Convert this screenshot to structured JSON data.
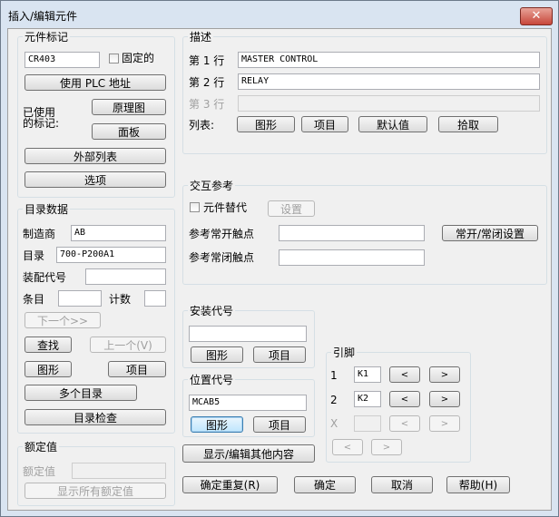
{
  "window": {
    "title": "插入/编辑元件",
    "close_glyph": "✕"
  },
  "component_tag": {
    "group_label": "元件标记",
    "tag_value": "CR403",
    "fixed_label": "固定的",
    "use_plc_label": "使用 PLC 地址",
    "used_tags_label_line1": "已使用",
    "used_tags_label_line2": "的标记:",
    "schematic_label": "原理图",
    "panel_label": "面板",
    "external_list_label": "外部列表",
    "options_label": "选项"
  },
  "catalog": {
    "group_label": "目录数据",
    "manufacturer_label": "制造商",
    "manufacturer_value": "AB",
    "catalog_label": "目录",
    "catalog_value": "700-P200A1",
    "assembly_label": "装配代号",
    "assembly_value": "",
    "item_label": "条目",
    "item_value": "",
    "count_label": "计数",
    "count_value": "",
    "next_label": "下一个>>",
    "lookup_label": "查找",
    "previous_label": "上一个(V)",
    "drawing_label": "图形",
    "project_label": "项目",
    "multiple_label": "多个目录",
    "check_label": "目录检查"
  },
  "ratings": {
    "group_label": "额定值",
    "rating_label": "额定值",
    "rating_value": "",
    "show_all_label": "显示所有额定值"
  },
  "description": {
    "group_label": "描述",
    "line1_label": "第 1 行",
    "line1_value": "MASTER CONTROL",
    "line2_label": "第 2 行",
    "line2_value": "RELAY",
    "line3_label": "第 3 行",
    "line3_value": "",
    "list_label": "列表:",
    "drawing_label": "图形",
    "project_label": "项目",
    "defaults_label": "默认值",
    "pick_label": "拾取"
  },
  "cross_ref": {
    "group_label": "交互参考",
    "override_label": "元件替代",
    "setup_label": "设置",
    "no_contacts_label": "参考常开触点",
    "no_contacts_value": "",
    "nc_contacts_label": "参考常闭触点",
    "nc_contacts_value": "",
    "no_nc_setup_label": "常开/常闭设置"
  },
  "installation": {
    "group_label": "安装代号",
    "value": "",
    "drawing_label": "图形",
    "project_label": "项目"
  },
  "location": {
    "group_label": "位置代号",
    "value": "MCAB5",
    "drawing_label": "图形",
    "project_label": "项目"
  },
  "pins": {
    "group_label": "引脚",
    "row1_label": "1",
    "row1_value": "K1",
    "row2_label": "2",
    "row2_value": "K2",
    "rowx_label": "X",
    "rowx_value": "",
    "left_glyph": "<",
    "right_glyph": ">"
  },
  "show_edit_misc_label": "显示/编辑其他内容",
  "footer": {
    "ok_repeat_label": "确定重复(R)",
    "ok_label": "确定",
    "cancel_label": "取消",
    "help_label": "帮助(H)"
  }
}
